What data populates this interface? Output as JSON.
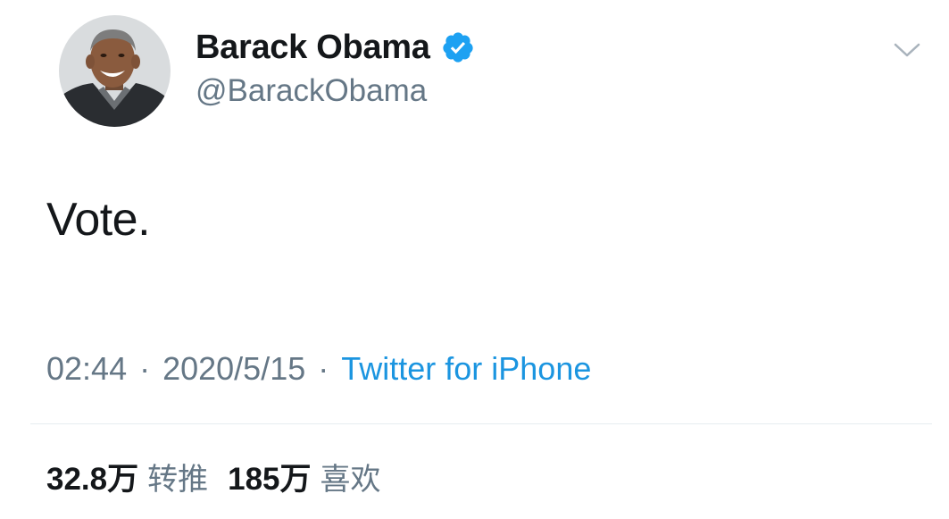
{
  "user": {
    "display_name": "Barack Obama",
    "handle": "@BarackObama",
    "verified": true
  },
  "tweet": {
    "text": "Vote."
  },
  "meta": {
    "time": "02:44",
    "separator": "·",
    "date": "2020/5/15",
    "source": "Twitter for iPhone"
  },
  "stats": {
    "retweets": {
      "count": "32.8万",
      "label": "转推"
    },
    "likes": {
      "count": "185万",
      "label": "喜欢"
    }
  },
  "icons": {
    "verified": "verified-badge-icon",
    "menu": "chevron-down-icon",
    "avatar": "profile-photo"
  },
  "colors": {
    "primary_text": "#14171a",
    "secondary_text": "#657786",
    "link": "#1b95e0",
    "verified_badge": "#1da1f2",
    "divider": "#e6ecf0"
  }
}
